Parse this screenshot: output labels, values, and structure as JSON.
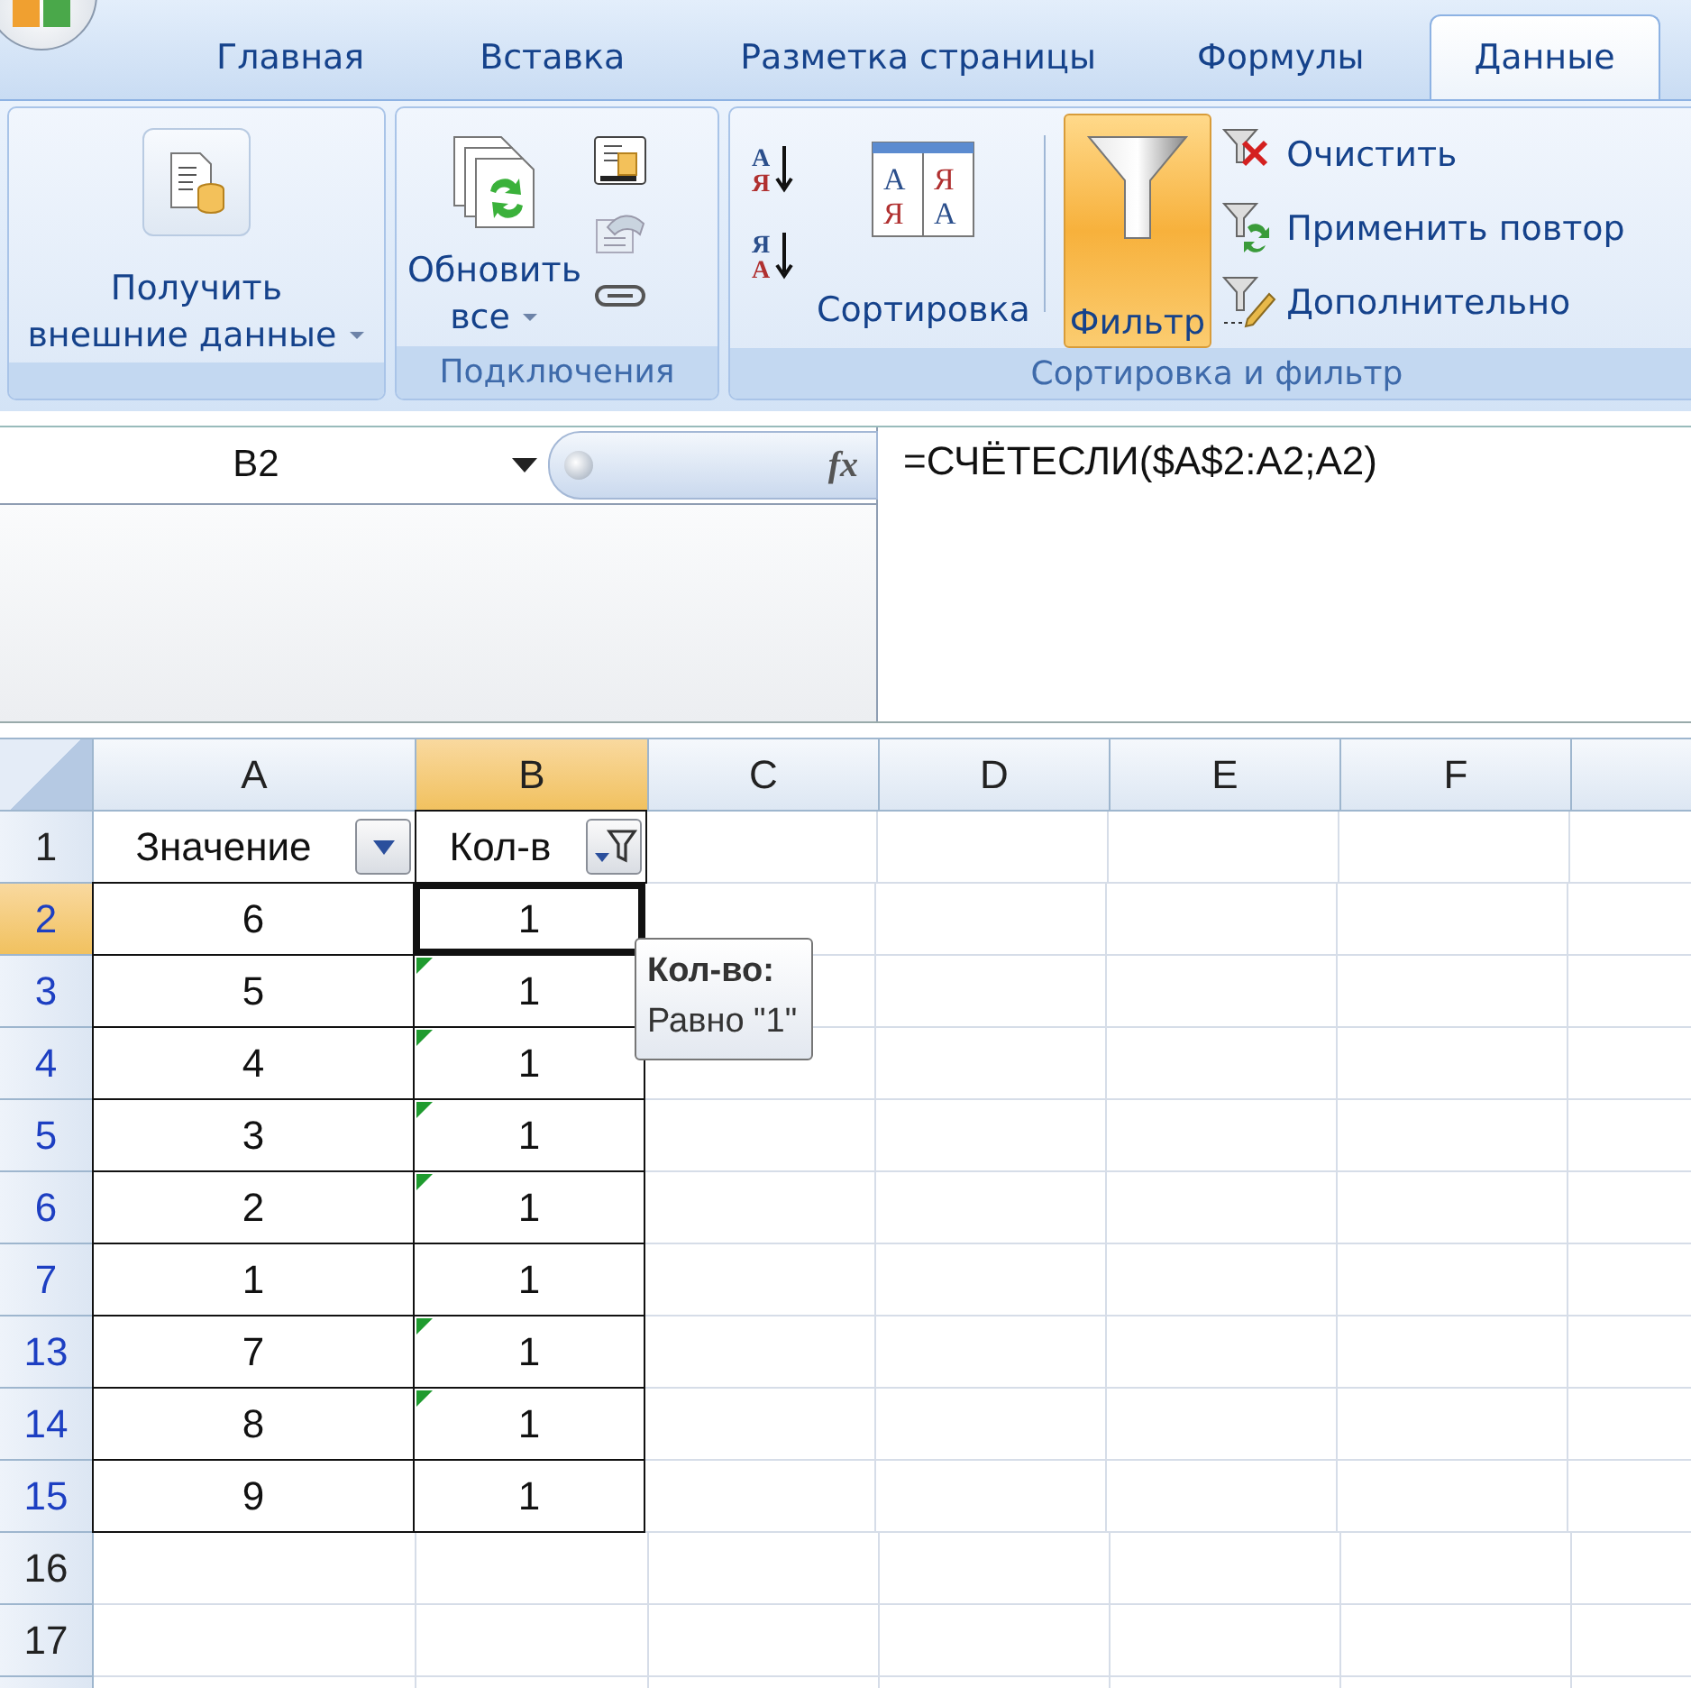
{
  "tabs": [
    {
      "label": "Главная",
      "selected": false
    },
    {
      "label": "Вставка",
      "selected": false
    },
    {
      "label": "Разметка страницы",
      "selected": false
    },
    {
      "label": "Формулы",
      "selected": false
    },
    {
      "label": "Данные",
      "selected": true
    }
  ],
  "ribbon": {
    "groups": [
      {
        "buttons": [
          {
            "lines": [
              "Получить",
              "внешние данные"
            ],
            "dropdown": true
          }
        ]
      },
      {
        "label": "Подключения",
        "buttons": [
          {
            "lines": [
              "Обновить",
              "все"
            ],
            "dropdown": true
          }
        ]
      },
      {
        "label": "Сортировка и фильтр",
        "sort_icons": [
          [
            "А",
            "Я"
          ],
          [
            "Я",
            "А"
          ]
        ],
        "sort_dialog_icon": [
          "А",
          "Я",
          "Я",
          "А"
        ],
        "buttons": [
          {
            "lines": [
              "Сортировка"
            ],
            "selected": false
          },
          {
            "lines": [
              "Фильтр"
            ],
            "selected": true
          }
        ],
        "commands": [
          {
            "label": "Очистить"
          },
          {
            "label": "Применить повтор"
          },
          {
            "label": "Дополнительно"
          }
        ]
      }
    ]
  },
  "formula_bar": {
    "name_box": "B2",
    "function_button": "fx",
    "formula": "=СЧЁТЕСЛИ($A$2:A2;A2)"
  },
  "grid": {
    "columns": [
      {
        "label": "A",
        "selected": false
      },
      {
        "label": "B",
        "selected": true
      },
      {
        "label": "C",
        "selected": false
      },
      {
        "label": "D",
        "selected": false
      },
      {
        "label": "E",
        "selected": false
      },
      {
        "label": "F",
        "selected": false
      }
    ],
    "rows": [
      {
        "header": "1",
        "filtered": false,
        "selected": false,
        "cells": [
          {
            "value": "Значение",
            "filter_active": false,
            "bordered": false
          },
          {
            "value": "Кол-в",
            "filter_active": true,
            "bordered": true
          }
        ]
      },
      {
        "header": "2",
        "filtered": true,
        "selected": true,
        "cells": [
          {
            "value": "6",
            "bordered": true
          },
          {
            "value": "1",
            "bordered": true,
            "selected": true,
            "error_mark": false
          }
        ]
      },
      {
        "header": "3",
        "filtered": true,
        "selected": false,
        "cells": [
          {
            "value": "5",
            "bordered": true
          },
          {
            "value": "1",
            "bordered": true,
            "selected": false,
            "error_mark": true
          }
        ]
      },
      {
        "header": "4",
        "filtered": true,
        "selected": false,
        "cells": [
          {
            "value": "4",
            "bordered": true
          },
          {
            "value": "1",
            "bordered": true,
            "selected": false,
            "error_mark": true
          }
        ]
      },
      {
        "header": "5",
        "filtered": true,
        "selected": false,
        "cells": [
          {
            "value": "3",
            "bordered": true
          },
          {
            "value": "1",
            "bordered": true,
            "selected": false,
            "error_mark": true
          }
        ]
      },
      {
        "header": "6",
        "filtered": true,
        "selected": false,
        "cells": [
          {
            "value": "2",
            "bordered": true
          },
          {
            "value": "1",
            "bordered": true,
            "selected": false,
            "error_mark": true
          }
        ]
      },
      {
        "header": "7",
        "filtered": true,
        "selected": false,
        "cells": [
          {
            "value": "1",
            "bordered": true
          },
          {
            "value": "1",
            "bordered": true,
            "selected": false,
            "error_mark": false
          }
        ]
      },
      {
        "header": "13",
        "filtered": true,
        "selected": false,
        "cells": [
          {
            "value": "7",
            "bordered": true
          },
          {
            "value": "1",
            "bordered": true,
            "selected": false,
            "error_mark": true
          }
        ]
      },
      {
        "header": "14",
        "filtered": true,
        "selected": false,
        "cells": [
          {
            "value": "8",
            "bordered": true
          },
          {
            "value": "1",
            "bordered": true,
            "selected": false,
            "error_mark": true
          }
        ]
      },
      {
        "header": "15",
        "filtered": true,
        "selected": false,
        "cells": [
          {
            "value": "9",
            "bordered": true
          },
          {
            "value": "1",
            "bordered": true,
            "selected": false,
            "error_mark": false
          }
        ]
      },
      {
        "header": "16",
        "filtered": false,
        "selected": false
      },
      {
        "header": "17",
        "filtered": false,
        "selected": false
      }
    ]
  },
  "tooltip": {
    "title": "Кол-во:",
    "text": "Равно \"1\""
  }
}
